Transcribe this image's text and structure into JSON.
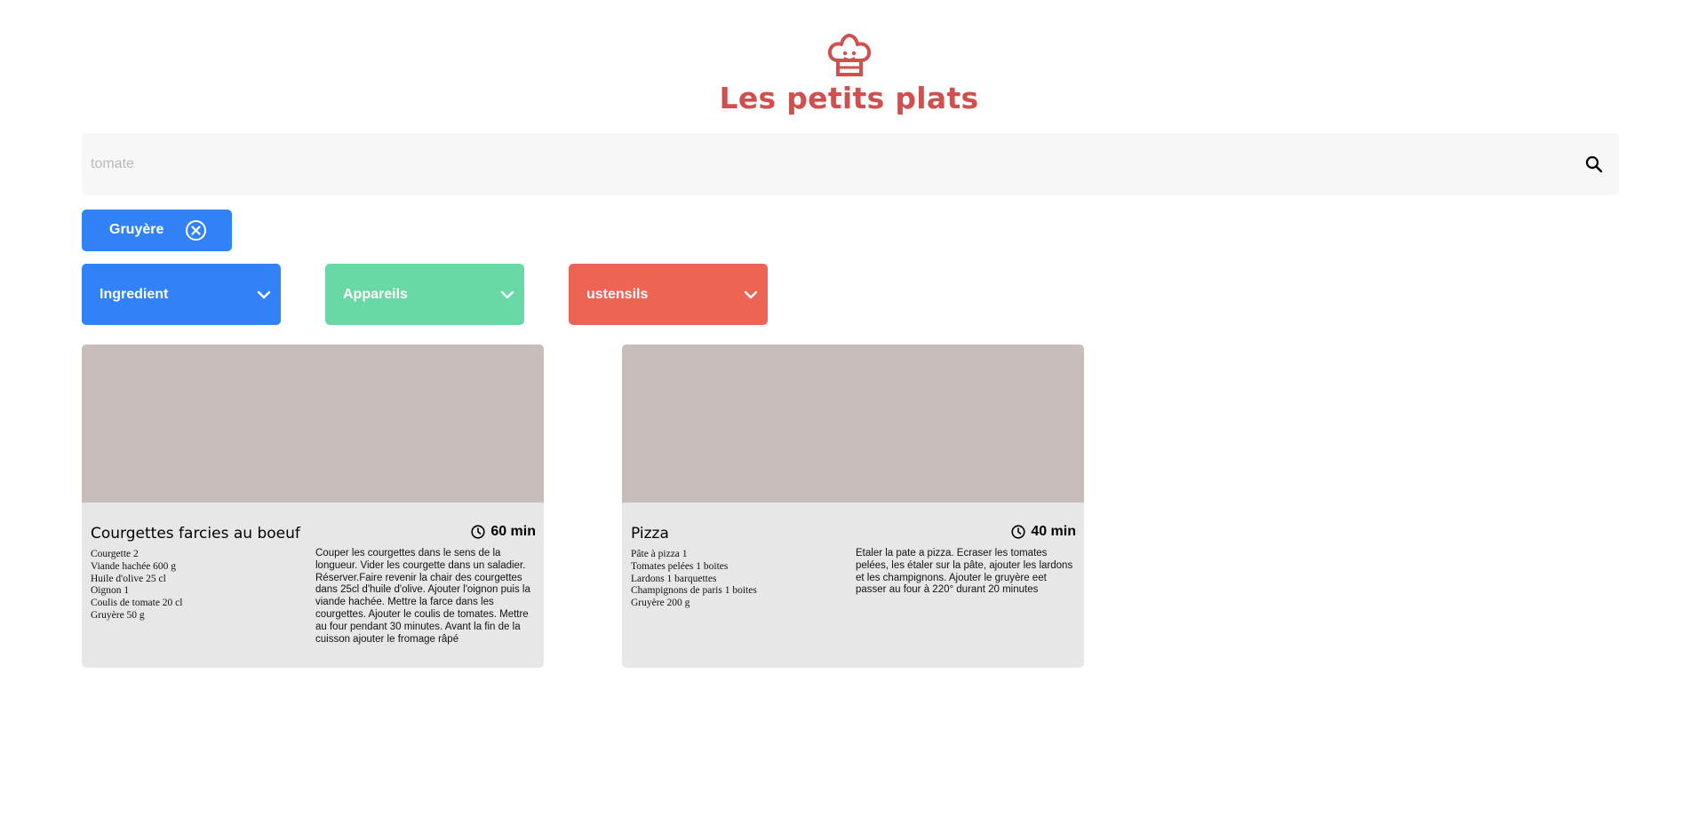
{
  "header": {
    "logo_icon": "chef-hat-icon",
    "title": "Les petits plats",
    "brand_color": "#d04f4f"
  },
  "search": {
    "placeholder": "tomate",
    "value": "",
    "icon": "search-icon"
  },
  "selected_tags": [
    {
      "label": "Gruyère",
      "color": "#3282f7",
      "icon": "close-circle-icon"
    }
  ],
  "filters": [
    {
      "label": "Ingredient",
      "color": "#3282f7",
      "icon": "chevron-down-icon"
    },
    {
      "label": "Appareils",
      "color": "#68d9a4",
      "icon": "chevron-down-icon"
    },
    {
      "label": "ustensils",
      "color": "#ed6454",
      "icon": "chevron-down-icon"
    }
  ],
  "recipes": [
    {
      "name": "Courgettes farcies au boeuf",
      "time": "60 min",
      "ingredients": [
        "Courgette 2",
        "Viande hachée 600 g",
        "Huile d'olive 25 cl",
        "Oignon 1",
        "Coulis de tomate 20 cl",
        "Gruyère 50 g"
      ],
      "description": "Couper les courgettes dans le sens de la longueur. Vider les courgette dans un saladier. Réserver.Faire revenir la chair des courgettes dans 25cl d'huile d'olive. Ajouter l'oignon puis la viande hachée. Mettre la farce dans les courgettes. Ajouter le coulis de tomates. Mettre au four pendant 30 minutes. Avant la fin de la cuisson ajouter le fromage râpé"
    },
    {
      "name": "Pizza",
      "time": "40 min",
      "ingredients": [
        "Pâte à pizza 1",
        "Tomates pelées 1 boites",
        "Lardons 1 barquettes",
        "Champignons de paris 1 boites",
        "Gruyère 200 g"
      ],
      "description": "Etaler la pate a pizza. Ecraser les tomates pelées, les étaler sur la pâte, ajouter les lardons et les champignons. Ajouter le gruyère eet passer au four à 220° durant 20 minutes"
    }
  ]
}
